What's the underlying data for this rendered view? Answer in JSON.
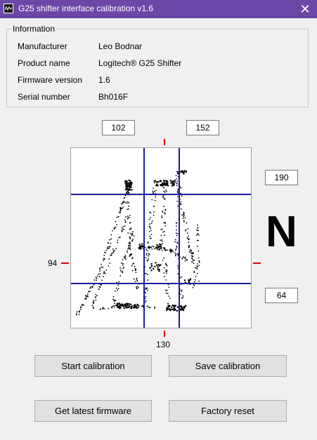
{
  "window": {
    "title": "G25 shifter interface calibration v1.6"
  },
  "info": {
    "legend": "Information",
    "rows": [
      {
        "label": "Manufacturer",
        "value": "Leo Bodnar"
      },
      {
        "label": "Product name",
        "value": "Logitech® G25 Shifter"
      },
      {
        "label": "Firmware version",
        "value": "1.6"
      },
      {
        "label": "Serial number",
        "value": "Bh016F"
      }
    ]
  },
  "calibration": {
    "x_low": "102",
    "x_high": "152",
    "y_high": "190",
    "y_low": "64",
    "x_center": "130",
    "y_center": "94",
    "gear": "N"
  },
  "buttons": {
    "start": "Start calibration",
    "save": "Save calibration",
    "firmware": "Get latest firmware",
    "reset": "Factory reset"
  }
}
